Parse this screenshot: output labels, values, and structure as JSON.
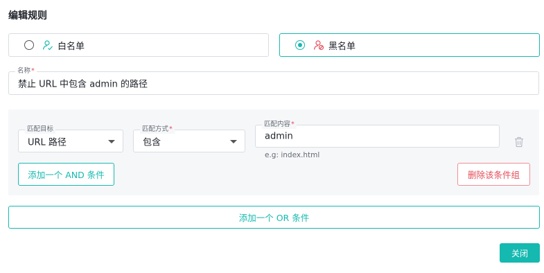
{
  "dialog": {
    "title": "编辑规则"
  },
  "rule_type": {
    "options": [
      {
        "label": "白名单",
        "selected": false,
        "icon": "user-check-icon"
      },
      {
        "label": "黑名单",
        "selected": true,
        "icon": "user-block-icon"
      }
    ]
  },
  "name_field": {
    "label": "名称",
    "required_mark": "*",
    "value": "禁止 URL 中包含 admin 的路径"
  },
  "condition_group": {
    "target": {
      "label": "匹配目标",
      "value": "URL 路径"
    },
    "method": {
      "label": "匹配方式",
      "required_mark": "*",
      "value": "包含"
    },
    "content": {
      "label": "匹配内容",
      "required_mark": "*",
      "value": "admin",
      "hint": "e.g: index.html"
    },
    "add_and_label": "添加一个 AND 条件",
    "delete_group_label": "删除该条件组"
  },
  "add_or_label": "添加一个 OR 条件",
  "close_label": "关闭",
  "colors": {
    "accent": "#15b9b0",
    "danger": "#e34d59",
    "panel_bg": "#f6f7f9",
    "border": "#d9dce1"
  }
}
